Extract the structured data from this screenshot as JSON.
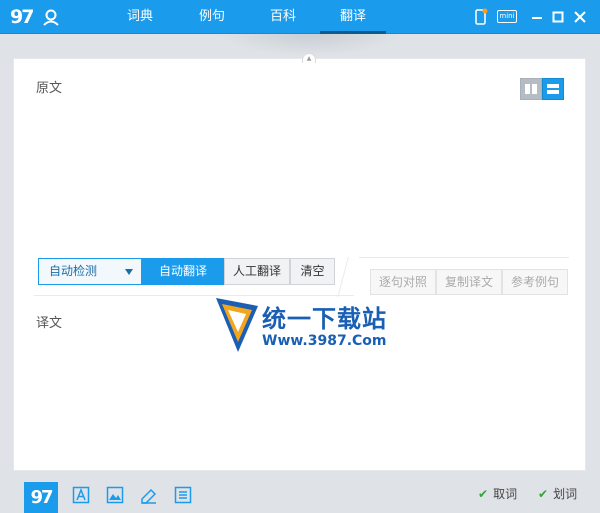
{
  "titlebar": {
    "logo_text": "97",
    "tabs": [
      {
        "label": "词典",
        "active": false
      },
      {
        "label": "例句",
        "active": false
      },
      {
        "label": "百科",
        "active": false
      },
      {
        "label": "翻译",
        "active": true
      }
    ],
    "mini_label": "mini"
  },
  "main": {
    "source_label": "原文",
    "source_value": "",
    "target_label": "译文",
    "language_select": "自动检测",
    "buttons": {
      "auto_translate": "自动翻译",
      "human_translate": "人工翻译",
      "clear": "清空",
      "sentence_compare": "逐句对照",
      "copy_translation": "复制译文",
      "reference_examples": "参考例句"
    }
  },
  "watermark": {
    "title": "统一下载站",
    "subtitle": "Www.3987.Com"
  },
  "bottombar": {
    "logo_text": "97",
    "fetch_word": "取词",
    "select_word": "划词"
  },
  "colors": {
    "accent": "#1a9bec",
    "check_green": "#2fa834"
  }
}
